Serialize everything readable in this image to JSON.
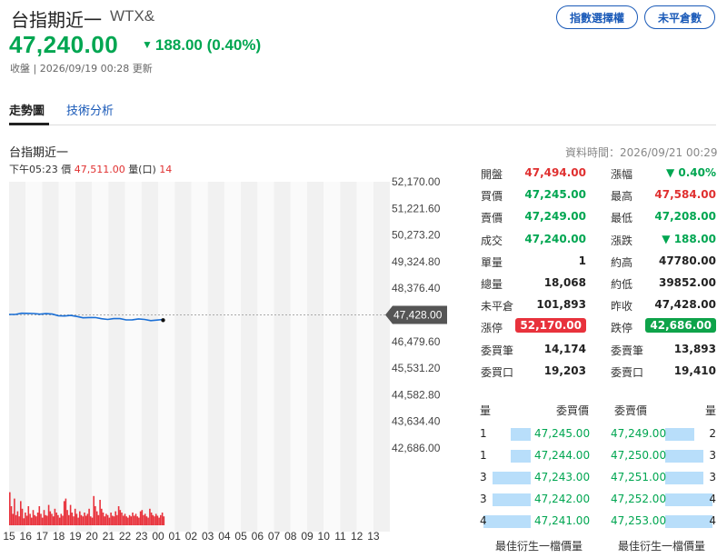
{
  "header": {
    "title": "台指期近一",
    "symbol": "WTX&",
    "price": "47,240.00",
    "change": "188.00 (0.40%)",
    "status_text": "收盤 | 2026/09/19 00:28 更新",
    "btn_warrant": "指數選擇權",
    "btn_open": "未平倉數"
  },
  "tabs": [
    {
      "label": "走勢圖",
      "active": true
    },
    {
      "label": "技術分析",
      "active": false
    }
  ],
  "chart_header": {
    "name": "台指期近一",
    "time": "下午05:23",
    "price_label": "價",
    "price": "47,511.00",
    "vol_label": "量(口)",
    "vol": "14",
    "data_time": "資料時間：2026/09/21 00:29"
  },
  "chart_data": {
    "type": "line",
    "y_ticks": [
      "52,170.00",
      "51,221.60",
      "50,273.20",
      "49,324.80",
      "48,376.40",
      "47,428.00",
      "46,479.60",
      "45,531.20",
      "44,582.80",
      "43,634.40",
      "42,686.00"
    ],
    "ylim": [
      42686,
      52170
    ],
    "x_ticks": [
      "15",
      "16",
      "17",
      "18",
      "19",
      "20",
      "21",
      "22",
      "23",
      "00",
      "01",
      "02",
      "03",
      "04",
      "05",
      "06",
      "07",
      "08",
      "09",
      "10",
      "11",
      "12",
      "13"
    ],
    "reference_value": 47428,
    "reference_label": "47,428.00",
    "series": [
      {
        "values": [
          47445,
          47470,
          47480,
          47460,
          47490,
          47475,
          47455,
          47440,
          47420,
          47400,
          47385,
          47370,
          47350,
          47330,
          47310,
          47300,
          47290,
          47280,
          47275,
          47270,
          47268,
          47262,
          47258,
          47250,
          47245,
          47240
        ]
      }
    ],
    "volume_max": 1000,
    "volume": [
      520,
      300,
      180,
      420,
      160,
      220,
      140,
      380,
      260,
      110,
      200,
      150,
      300,
      180,
      120,
      240,
      160,
      140,
      200,
      300,
      180,
      120,
      240,
      160,
      150,
      320,
      220,
      180,
      140,
      260,
      200,
      160,
      120,
      180,
      150,
      380,
      420,
      240,
      160,
      320,
      200,
      140,
      260,
      180,
      120,
      220,
      160,
      140,
      200,
      150,
      180,
      260,
      140,
      120,
      460,
      300,
      220,
      160,
      400,
      260,
      200,
      140,
      180,
      160,
      120,
      200,
      150,
      140,
      220,
      160,
      300,
      240,
      200,
      150,
      180,
      140,
      120,
      160,
      140,
      200,
      150,
      180,
      140,
      120,
      220,
      240,
      160,
      180,
      140,
      120,
      260,
      200,
      160,
      140,
      180,
      150,
      120,
      160,
      200,
      140
    ]
  },
  "quote": {
    "left": [
      {
        "label": "開盤",
        "value": "47,494.00",
        "color": "red"
      },
      {
        "label": "買價",
        "value": "47,245.00",
        "color": "green"
      },
      {
        "label": "賣價",
        "value": "47,249.00",
        "color": "green"
      },
      {
        "label": "成交",
        "value": "47,240.00",
        "color": "green"
      },
      {
        "label": "單量",
        "value": "1",
        "color": "black"
      },
      {
        "label": "總量",
        "value": "18,068",
        "color": "black"
      },
      {
        "label": "未平倉",
        "value": "101,893",
        "color": "black"
      },
      {
        "label": "漲停",
        "value": "52,170.00",
        "color": "badge-red"
      },
      {
        "label": "委買筆",
        "value": "14,174",
        "color": "black"
      },
      {
        "label": "委買口",
        "value": "19,203",
        "color": "black"
      }
    ],
    "right": [
      {
        "label": "漲幅",
        "value": "▼ 0.40%",
        "color": "green"
      },
      {
        "label": "最高",
        "value": "47,584.00",
        "color": "red"
      },
      {
        "label": "最低",
        "value": "47,208.00",
        "color": "green"
      },
      {
        "label": "漲跌",
        "value": "▼ 188.00",
        "color": "green"
      },
      {
        "label": "約高",
        "value": "47780.00",
        "color": "black"
      },
      {
        "label": "約低",
        "value": "39852.00",
        "color": "black"
      },
      {
        "label": "昨收",
        "value": "47,428.00",
        "color": "black"
      },
      {
        "label": "跌停",
        "value": "42,686.00",
        "color": "badge-green"
      },
      {
        "label": "委賣筆",
        "value": "13,893",
        "color": "black"
      },
      {
        "label": "委賣口",
        "value": "19,410",
        "color": "black"
      }
    ]
  },
  "order_book": {
    "head": {
      "qty": "量",
      "bid": "委買價",
      "ask": "委賣價",
      "qty2": "量"
    },
    "rows": [
      {
        "bid_qty": "1",
        "bid": "47,245.00",
        "ask": "47,249.00",
        "ask_qty": "2",
        "bid_share": 0.25,
        "ask_share": 0.5
      },
      {
        "bid_qty": "1",
        "bid": "47,244.00",
        "ask": "47,250.00",
        "ask_qty": "3",
        "bid_share": 0.25,
        "ask_share": 0.75
      },
      {
        "bid_qty": "3",
        "bid": "47,243.00",
        "ask": "47,251.00",
        "ask_qty": "3",
        "bid_share": 0.75,
        "ask_share": 0.75
      },
      {
        "bid_qty": "3",
        "bid": "47,242.00",
        "ask": "47,252.00",
        "ask_qty": "4",
        "bid_share": 0.75,
        "ask_share": 1.0
      },
      {
        "bid_qty": "4",
        "bid": "47,241.00",
        "ask": "47,253.00",
        "ask_qty": "4",
        "bid_share": 1.0,
        "ask_share": 1.0
      }
    ],
    "footer_left": "最佳衍生一檔價量",
    "footer_right": "最佳衍生一檔價量"
  },
  "colors": {
    "up": "#e03030",
    "down": "#00a651",
    "line": "#1a6fd6",
    "bar": "#e8323c",
    "bidbar": "#b8defa"
  }
}
